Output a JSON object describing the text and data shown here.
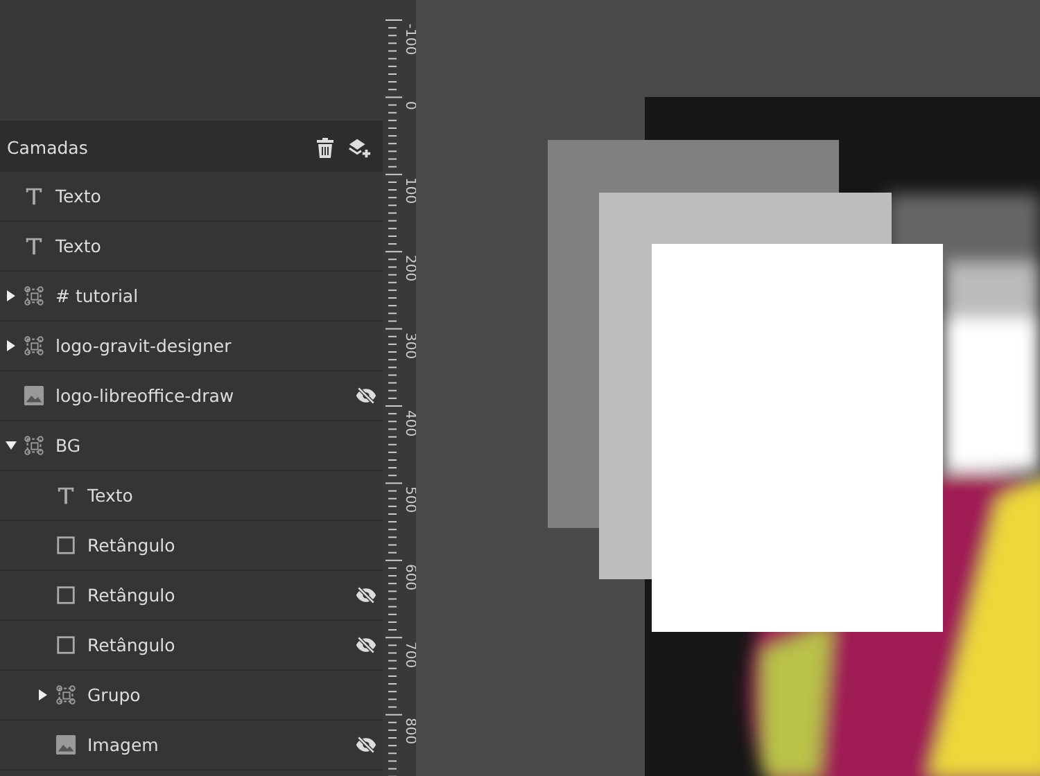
{
  "layers_panel": {
    "title": "Camadas",
    "items": [
      {
        "kind": "text",
        "label": "Texto",
        "hidden": false
      },
      {
        "kind": "text",
        "label": "Texto",
        "hidden": false
      },
      {
        "kind": "group",
        "label": "# tutorial",
        "hidden": false,
        "expanded": false
      },
      {
        "kind": "group",
        "label": "logo-gravit-designer",
        "hidden": false,
        "expanded": false
      },
      {
        "kind": "image",
        "label": "logo-libreoffice-draw",
        "hidden": true
      },
      {
        "kind": "group",
        "label": "BG",
        "hidden": false,
        "expanded": true,
        "children": [
          {
            "kind": "text",
            "label": "Texto",
            "hidden": false
          },
          {
            "kind": "rect",
            "label": "Retângulo",
            "hidden": false
          },
          {
            "kind": "rect",
            "label": "Retângulo",
            "hidden": true
          },
          {
            "kind": "rect",
            "label": "Retângulo",
            "hidden": true
          },
          {
            "kind": "group",
            "label": "Grupo",
            "hidden": false,
            "expanded": false
          },
          {
            "kind": "image",
            "label": "Imagem",
            "hidden": true
          }
        ]
      }
    ]
  },
  "ruler": {
    "labels": [
      "-100",
      "0",
      "100",
      "200",
      "300",
      "400",
      "500",
      "600",
      "700",
      "800"
    ]
  }
}
